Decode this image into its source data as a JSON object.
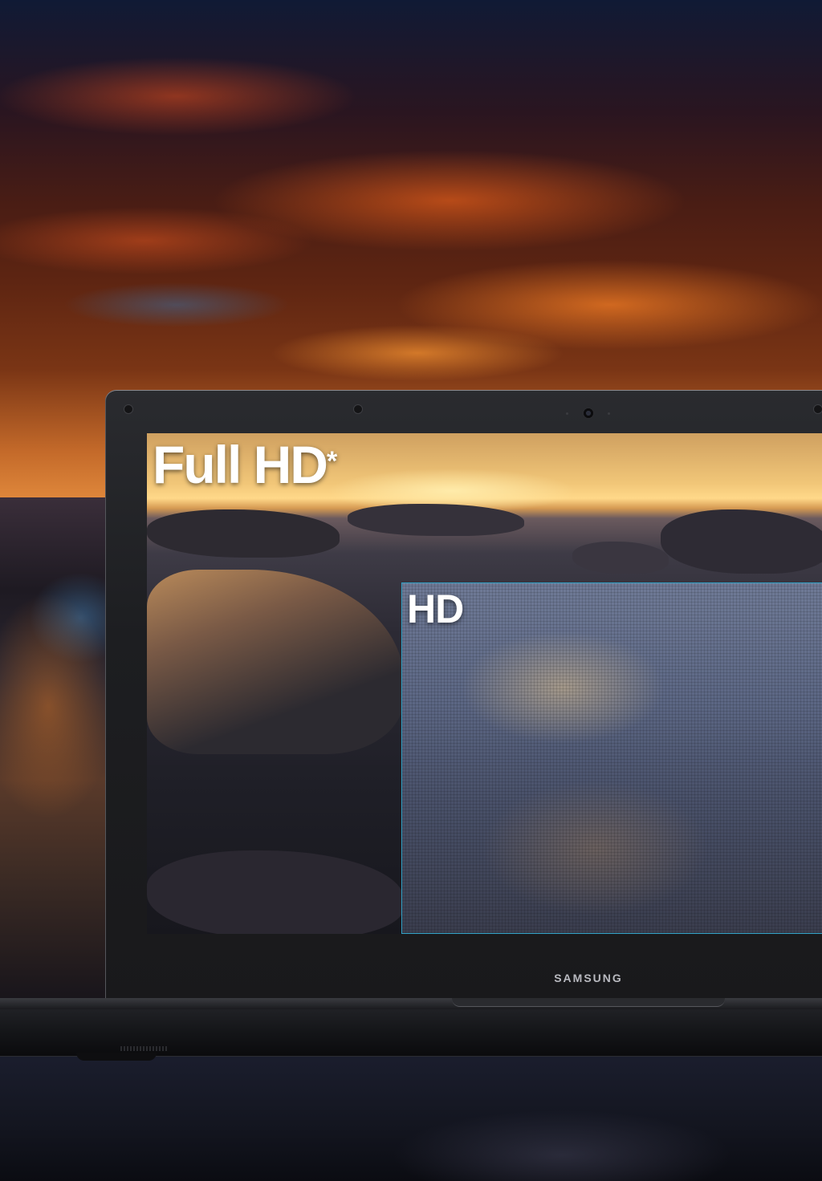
{
  "screen": {
    "full_hd_label": "Full HD",
    "full_hd_mark": "*",
    "hd_label": "HD"
  },
  "laptop": {
    "brand": "SAMSUNG"
  },
  "colors": {
    "hd_frame": "#33a3c8",
    "label_text": "#ffffff",
    "bezel": "#1d1e21"
  }
}
